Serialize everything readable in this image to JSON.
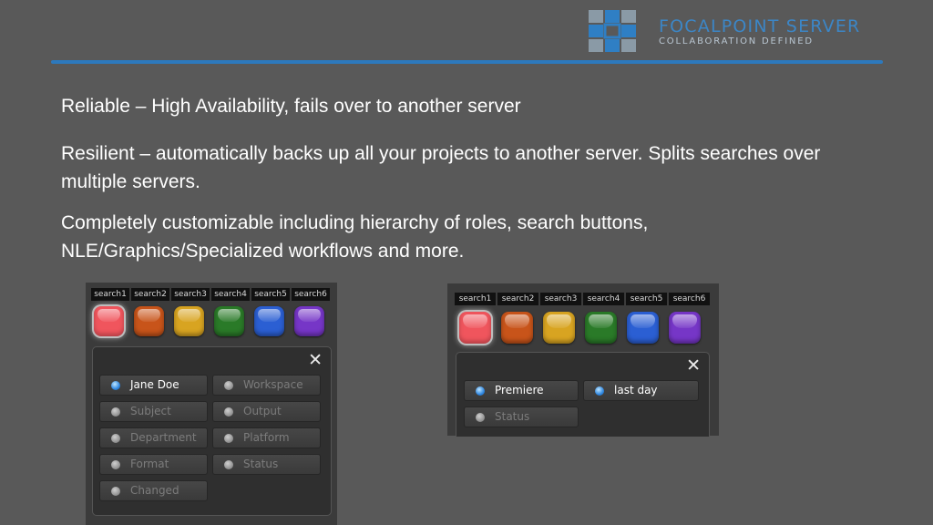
{
  "brand": {
    "name": "FOCALPOINT SERVER",
    "tagline": "COLLABORATION DEFINED",
    "accent_color": "#2d79bd"
  },
  "bullets": [
    "Reliable – High Availability, fails over to another server",
    "Resilient – automatically backs up all your projects to another server. Splits searches over multiple servers.",
    "Completely customizable including hierarchy of roles,  search buttons, NLE/Graphics/Specialized workflows and more."
  ],
  "panels": [
    {
      "tabs": [
        "search1",
        "search2",
        "search3",
        "search4",
        "search5",
        "search6"
      ],
      "swatch_colors": [
        "#f0555d",
        "#c8541a",
        "#d8a421",
        "#2a7a28",
        "#2b5fd3",
        "#7636c7"
      ],
      "active_swatch": 0,
      "close_icon": "close-icon",
      "filters": [
        {
          "label": "Jane Doe",
          "active": true
        },
        {
          "label": "Workspace",
          "active": false
        },
        {
          "label": "Subject",
          "active": false
        },
        {
          "label": "Output",
          "active": false
        },
        {
          "label": "Department",
          "active": false
        },
        {
          "label": "Platform",
          "active": false
        },
        {
          "label": "Format",
          "active": false
        },
        {
          "label": "Status",
          "active": false
        },
        {
          "label": "Changed",
          "active": false
        }
      ]
    },
    {
      "tabs": [
        "search1",
        "search2",
        "search3",
        "search4",
        "search5",
        "search6"
      ],
      "swatch_colors": [
        "#f0555d",
        "#c8541a",
        "#d8a421",
        "#2a7a28",
        "#2b5fd3",
        "#7636c7"
      ],
      "active_swatch": 0,
      "close_icon": "close-icon",
      "filters": [
        {
          "label": "Premiere",
          "active": true
        },
        {
          "label": "last day",
          "active": true
        },
        {
          "label": "Status",
          "active": false
        }
      ]
    }
  ]
}
